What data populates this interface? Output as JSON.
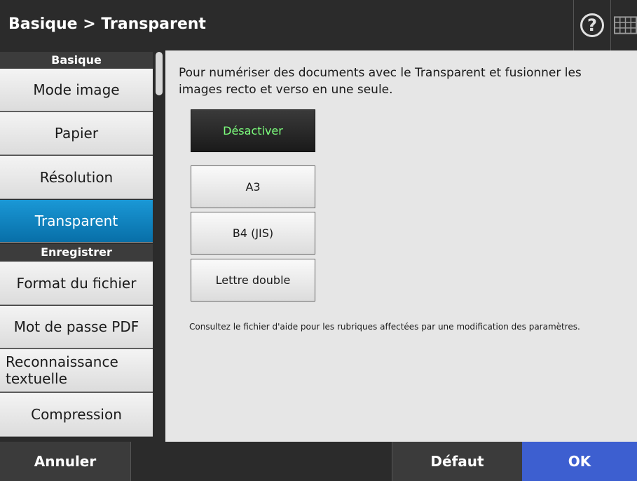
{
  "header": {
    "title": "Basique > Transparent",
    "help_label": "?"
  },
  "sidebar": {
    "sections": [
      {
        "label": "Basique",
        "items": [
          {
            "label": "Mode image"
          },
          {
            "label": "Papier"
          },
          {
            "label": "Résolution"
          },
          {
            "label": "Transparent",
            "active": true
          }
        ]
      },
      {
        "label": "Enregistrer",
        "items": [
          {
            "label": "Format du fichier"
          },
          {
            "label": "Mot de passe PDF"
          },
          {
            "label": "Reconnaissance textuelle"
          },
          {
            "label": "Compression"
          }
        ]
      }
    ]
  },
  "main": {
    "description": "Pour numériser des documents avec le Transparent et fusionner les images recto et verso en une seule.",
    "options": [
      {
        "label": "Désactiver",
        "selected": true
      },
      {
        "label": "A3"
      },
      {
        "label": "B4 (JIS)"
      },
      {
        "label": "Lettre double"
      }
    ],
    "note": "Consultez le fichier d'aide pour les rubriques affectées par une modification des paramètres."
  },
  "footer": {
    "cancel_label": "Annuler",
    "default_label": "Défaut",
    "ok_label": "OK"
  },
  "colors": {
    "active_item": "#1a98d6",
    "ok_button": "#3d5fd0",
    "selected_text": "#7dff7d"
  }
}
